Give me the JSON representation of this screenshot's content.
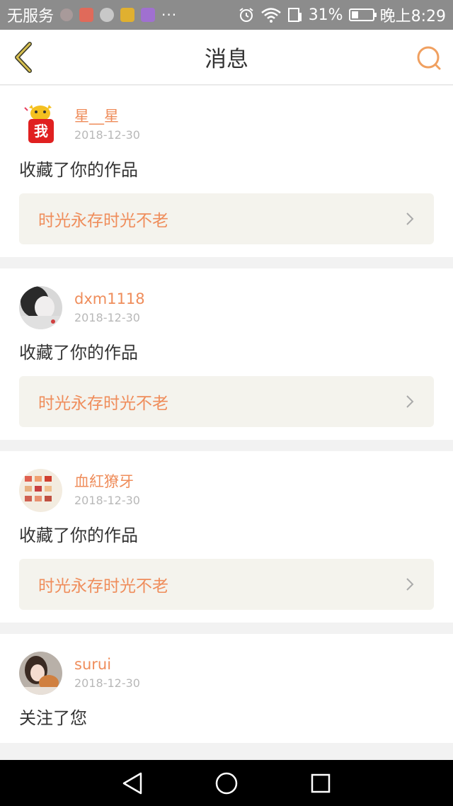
{
  "status_bar": {
    "carrier": "无服务",
    "dots": "···",
    "battery": "31%",
    "time": "晚上8:29",
    "app_colors": [
      "#d9a0a0",
      "#e06a5a",
      "#b8c0c0",
      "#e0b030",
      "#a070d0"
    ]
  },
  "header": {
    "title": "消息",
    "accent": "#ef8d5b",
    "back_color": "#c8b040"
  },
  "messages": [
    {
      "username": "星__星",
      "date": "2018-12-30",
      "action": "收藏了你的作品",
      "work_title": "时光永存时光不老",
      "avatar_text": "我"
    },
    {
      "username": "dxm1118",
      "date": "2018-12-30",
      "action": "收藏了你的作品",
      "work_title": "时光永存时光不老"
    },
    {
      "username": "血紅獠牙",
      "date": "2018-12-30",
      "action": "收藏了你的作品",
      "work_title": "时光永存时光不老"
    },
    {
      "username": "surui",
      "date": "2018-12-30",
      "action": "关注了您"
    }
  ]
}
